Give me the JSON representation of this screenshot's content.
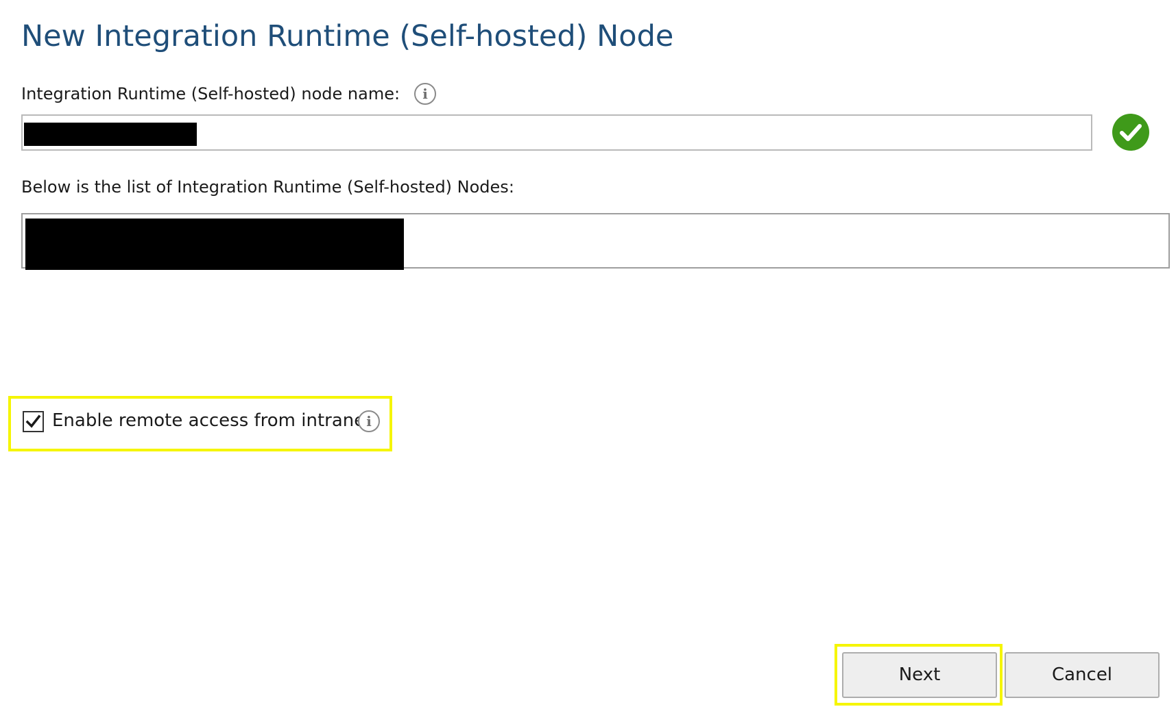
{
  "dialog": {
    "title": "New Integration Runtime (Self-hosted) Node"
  },
  "node_name": {
    "label": "Integration Runtime (Self-hosted) node name:",
    "info_icon": "info-icon",
    "value": "",
    "value_redacted": true,
    "status_icon": "green-checkmark-icon"
  },
  "nodes_list": {
    "label": "Below is the list of Integration Runtime (Self-hosted) Nodes:",
    "items_redacted": true
  },
  "remote_access": {
    "label": "Enable remote access from intranet",
    "checked": true,
    "info_icon": "info-icon"
  },
  "buttons": {
    "next_label": "Next",
    "cancel_label": "Cancel"
  },
  "colors": {
    "title": "#1f4e79",
    "success": "#3f9a1a",
    "highlight": "#f5f500",
    "button_bg": "#eeeeee",
    "redaction": "#000000"
  }
}
